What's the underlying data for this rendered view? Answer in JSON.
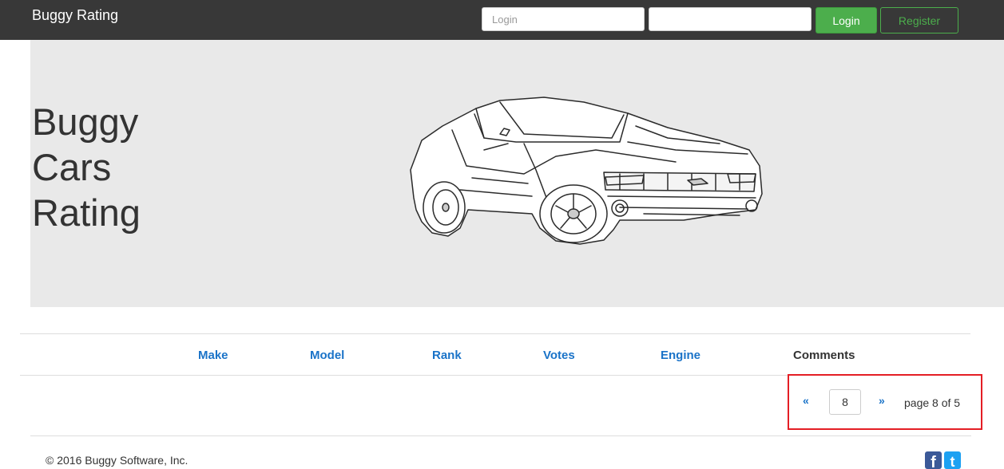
{
  "navbar": {
    "brand": "Buggy Rating",
    "login_placeholder": "Login",
    "password_value": "",
    "login_button": "Login",
    "register_button": "Register"
  },
  "hero": {
    "title_lines": [
      "Buggy",
      "Cars",
      "Rating"
    ],
    "background": "#e9e9e9"
  },
  "table": {
    "headers": [
      {
        "label": "Make",
        "sortable": true
      },
      {
        "label": "Model",
        "sortable": true
      },
      {
        "label": "Rank",
        "sortable": true
      },
      {
        "label": "Votes",
        "sortable": true
      },
      {
        "label": "Engine",
        "sortable": true
      },
      {
        "label": "Comments",
        "sortable": false
      }
    ],
    "rows": []
  },
  "pagination": {
    "prev": "«",
    "page_input_value": "8",
    "next": "»",
    "page_text": "page 8 of 5"
  },
  "footer": {
    "copyright": "© 2016 Buggy Software, Inc.",
    "social": [
      {
        "icon": "facebook-icon",
        "glyph": "f"
      },
      {
        "icon": "twitter-icon",
        "glyph": "t"
      }
    ]
  },
  "colors": {
    "navbar": "#383838",
    "accent_green": "#4cae4c",
    "link_blue": "#1a73c8",
    "highlight_red": "#e41e25"
  }
}
